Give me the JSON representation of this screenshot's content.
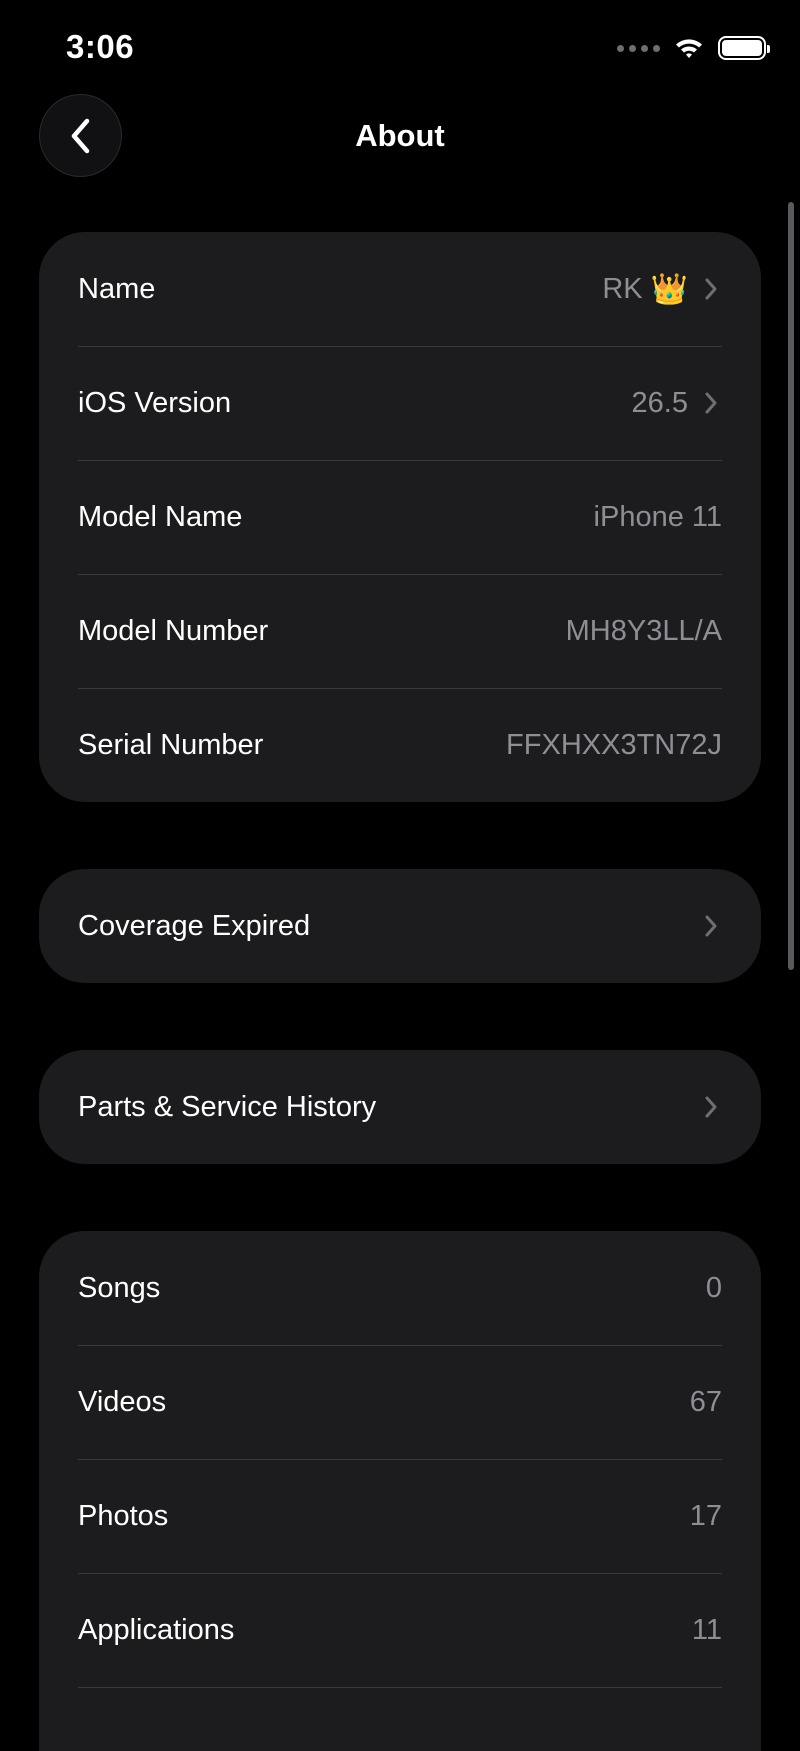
{
  "status_bar": {
    "time": "3:06",
    "icons": [
      "cellular-signal-icon",
      "wifi-icon",
      "battery-icon"
    ]
  },
  "nav": {
    "back_icon": "chevron-left-icon",
    "title": "About"
  },
  "device_info": [
    {
      "label": "Name",
      "value": "RK",
      "emoji": "👑",
      "has_chevron": true
    },
    {
      "label": "iOS Version",
      "value": "26.5",
      "has_chevron": true
    },
    {
      "label": "Model Name",
      "value": "iPhone 11",
      "has_chevron": false
    },
    {
      "label": "Model Number",
      "value": "MH8Y3LL/A",
      "has_chevron": false
    },
    {
      "label": "Serial Number",
      "value": "FFXHXX3TN72J",
      "has_chevron": false
    }
  ],
  "coverage": {
    "label": "Coverage Expired",
    "has_chevron": true
  },
  "service": {
    "label": "Parts & Service History",
    "has_chevron": true
  },
  "media_counts": [
    {
      "label": "Songs",
      "value": "0"
    },
    {
      "label": "Videos",
      "value": "67"
    },
    {
      "label": "Photos",
      "value": "17"
    },
    {
      "label": "Applications",
      "value": "11"
    }
  ],
  "colors": {
    "background": "#000000",
    "group_background": "#1c1c1e",
    "secondary_text": "#8e8e93",
    "separator": "#3a3a3d"
  }
}
